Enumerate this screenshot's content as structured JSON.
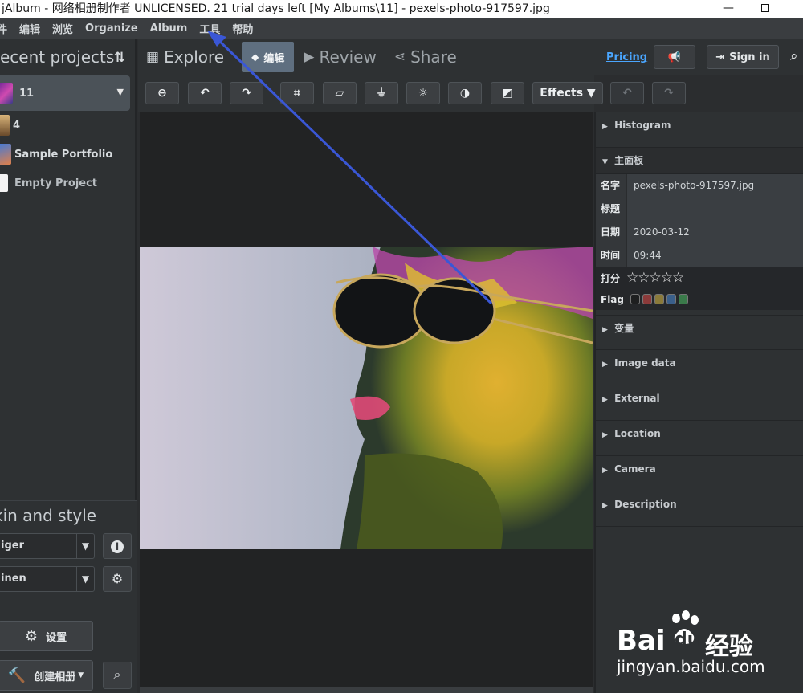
{
  "window": {
    "title": "jAlbum - 网络相册制作者 UNLICENSED. 21 trial days left [My Albums\\11] - pexels-photo-917597.jpg",
    "minimize": "—"
  },
  "menu": [
    "件",
    "编辑",
    "浏览",
    "Organize",
    "Album",
    "工具",
    "帮助"
  ],
  "left": {
    "recent_title": "ecent projects",
    "sort_icon": "⇅",
    "projects": [
      {
        "name": "11",
        "selected": true
      },
      {
        "name": "4"
      },
      {
        "name": "Sample Portfolio"
      },
      {
        "name": "Empty Project"
      }
    ],
    "skin_title": "kin and style",
    "skin_value": "iger",
    "style_value": "inen",
    "settings_label": "设置",
    "create_album_label": "创建相册"
  },
  "tabs": {
    "explore": "Explore",
    "edit": "编辑",
    "review": "Review",
    "share": "Share",
    "pricing": "Pricing",
    "sign_in": "Sign in"
  },
  "toolbar": {
    "effects": "Effects"
  },
  "right": {
    "histogram": "Histogram",
    "main_panel": "主面板",
    "fields": [
      {
        "key": "名字",
        "value": "pexels-photo-917597.jpg"
      },
      {
        "key": "标题",
        "value": ""
      },
      {
        "key": "日期",
        "value": "2020-03-12"
      },
      {
        "key": "时间",
        "value": "09:44"
      }
    ],
    "rating_label": "打分",
    "rating_stars": "☆☆☆☆☆",
    "flag_label": "Flag",
    "flag_colors": [
      "#1e1f20",
      "#8b3a3a",
      "#8a7a3a",
      "#3a5f8a",
      "#3a7a4a"
    ],
    "sections": [
      "变量",
      "Image data",
      "External",
      "Location",
      "Camera",
      "Description"
    ]
  },
  "watermark": {
    "brand": "Bai",
    "brand2": "du",
    "cn": "经验",
    "url": "jingyan.baidu.com"
  },
  "accent": "#4aa6ff",
  "annotation_arrow_color": "#3a57d6"
}
